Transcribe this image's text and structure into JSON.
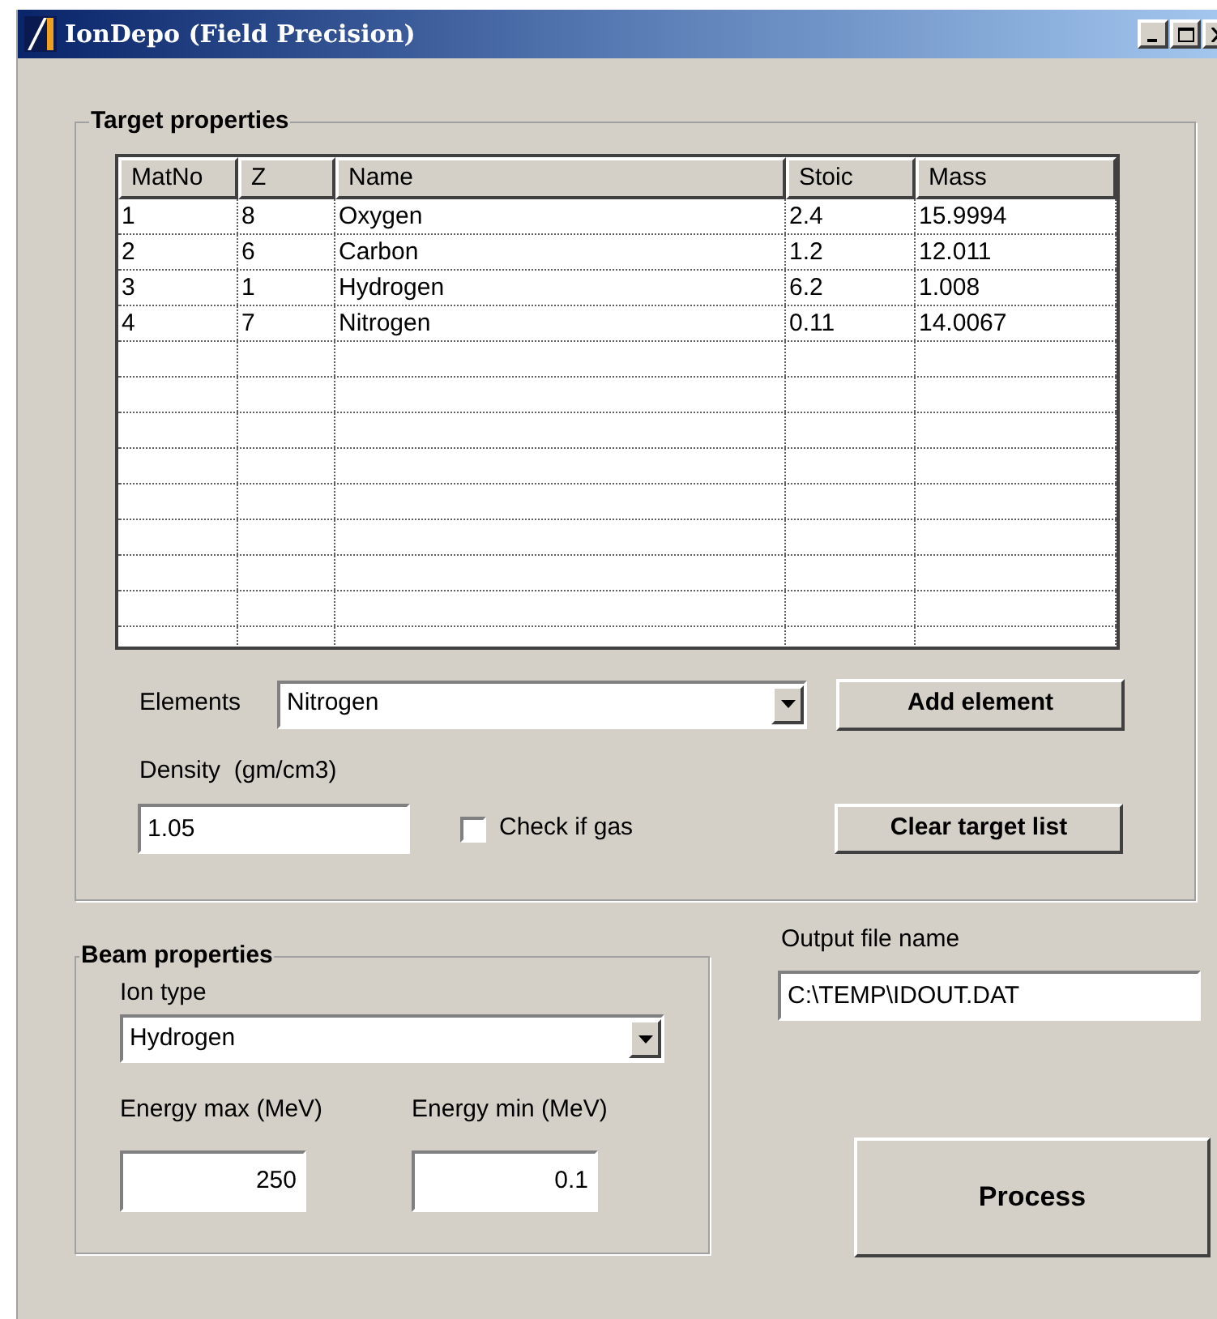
{
  "window": {
    "title": "IonDepo (Field Precision)"
  },
  "target": {
    "title": "Target properties",
    "table": {
      "columns": [
        "MatNo",
        "Z",
        "Name",
        "Stoic",
        "Mass"
      ],
      "rows": [
        [
          "1",
          "8",
          "Oxygen",
          "2.4",
          "15.9994"
        ],
        [
          "2",
          "6",
          "Carbon",
          "1.2",
          "12.011"
        ],
        [
          "3",
          "1",
          "Hydrogen",
          "6.2",
          "1.008"
        ],
        [
          "4",
          "7",
          "Nitrogen",
          "0.11",
          "14.0067"
        ]
      ]
    },
    "elements": {
      "label": "Elements",
      "value": "Nitrogen"
    },
    "add_button": "Add element",
    "density": {
      "label": "Density  (gm/cm3)",
      "value": "1.05"
    },
    "gas": {
      "label": "Check if gas",
      "checked": false
    },
    "clear_button": "Clear target list"
  },
  "beam": {
    "title": "Beam properties",
    "ion": {
      "label": "Ion type",
      "value": "Hydrogen"
    },
    "energy_max": {
      "label": "Energy max (MeV)",
      "value": "250"
    },
    "energy_min": {
      "label": "Energy min (MeV)",
      "value": "0.1"
    }
  },
  "output": {
    "label": "Output file name",
    "value": "C:\\TEMP\\IDOUT.DAT"
  },
  "process_button": "Process"
}
